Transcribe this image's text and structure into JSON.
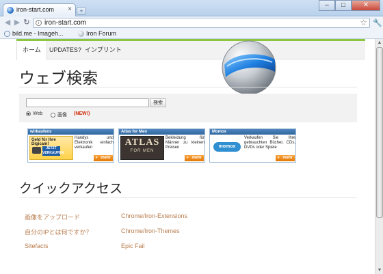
{
  "window": {
    "tab_title": "iron-start.com",
    "tab_close": "×",
    "new_tab": "+",
    "minimize": "–",
    "maximize": "□",
    "close": "✕"
  },
  "toolbar": {
    "back": "◀",
    "forward": "▶",
    "reload": "↻",
    "url": "iron-start.com",
    "star": "☆",
    "wrench": "🔧"
  },
  "bookmarks": [
    {
      "label": "bild.me - Imageh...",
      "color": "#6e8fb0"
    },
    {
      "label": "Iron Forum",
      "color": "#8a9bab"
    }
  ],
  "nav": {
    "items": [
      "ホーム",
      "UPDATES?",
      "インプリント"
    ]
  },
  "search": {
    "heading": "ウェブ検索",
    "placeholder": "",
    "button": "検索",
    "radio_web": "Web",
    "radio_images": "画像",
    "new_badge": "(NEW!)"
  },
  "ads": [
    {
      "title": "wirkaufens",
      "text": "Handys und Elektronik einfach verkaufen",
      "img_line1": "Geld für Ihre Digicam!",
      "img_line2": "JETZT VERKAUFEN",
      "more": "mehr"
    },
    {
      "title": "Atlas for Men",
      "text": "Bekleidung für Männer zu kleinen Preisen",
      "img_line1": "ATLAS",
      "img_line2": "FOR MEN",
      "more": "mehr"
    },
    {
      "title": "Momox",
      "text": "Verkaufen Sie Ihre gebrauchten Bücher, CDs, DVDs oder Spiele",
      "img_line1": "momox",
      "more": "mehr"
    }
  ],
  "quick": {
    "heading": "クイックアクセス",
    "left": [
      "画像をアップロード",
      "自分のIPとは何ですか？",
      "Sitefacts"
    ],
    "right": [
      "Chrome/Iron-Extensions",
      "Chrome/Iron-Themes",
      "Epic Fail"
    ]
  },
  "colors": {
    "accent_green": "#8cc63f",
    "link": "#b77a4a",
    "ad_more": "#e37a05"
  }
}
